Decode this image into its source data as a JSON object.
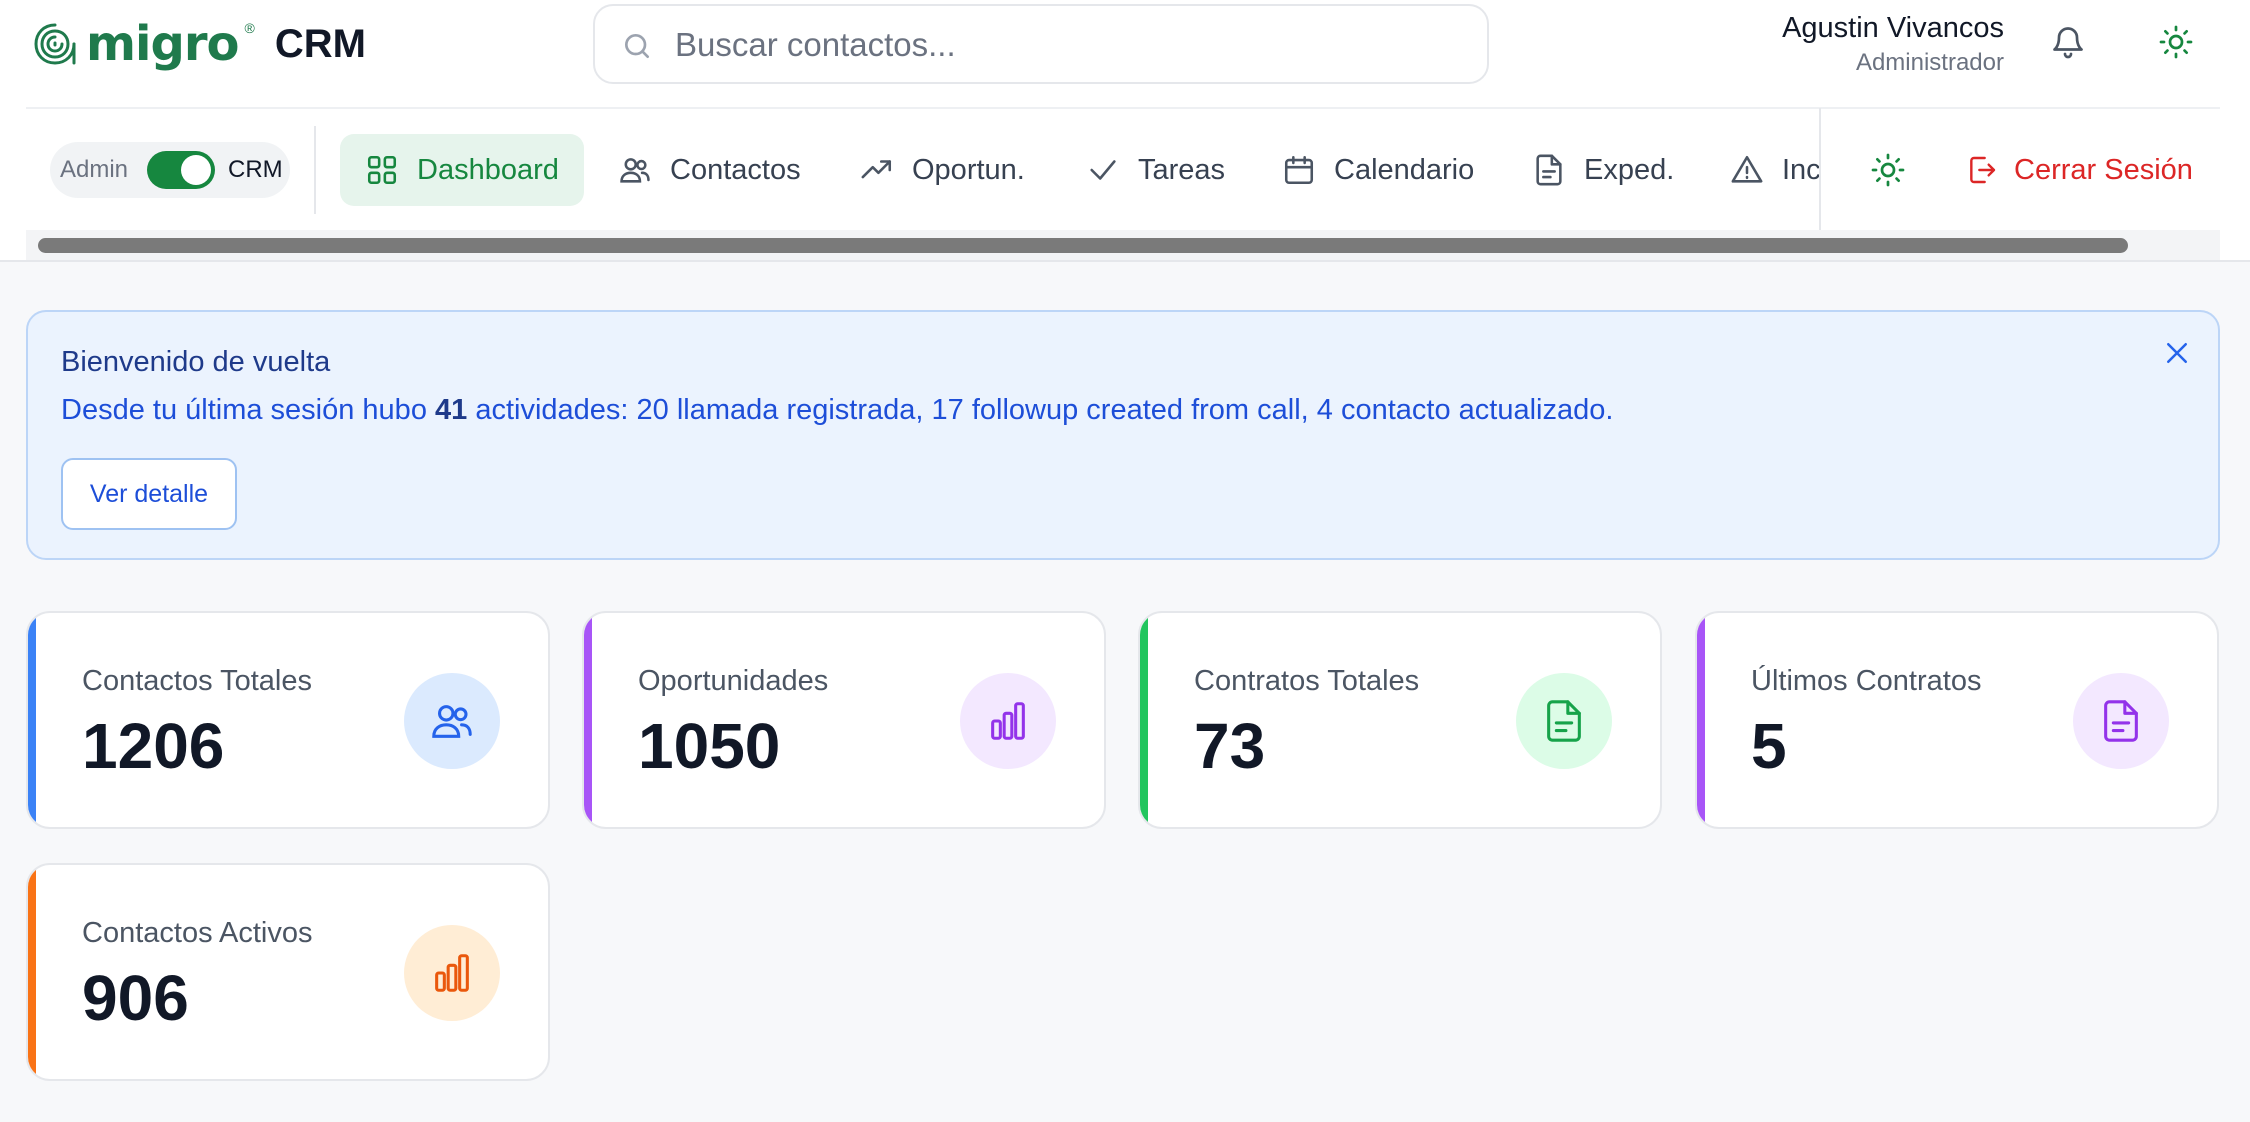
{
  "app": {
    "logo_text": "migro",
    "logo_reg": "®",
    "product": "CRM"
  },
  "search": {
    "placeholder": "Buscar contactos...",
    "value": ""
  },
  "user": {
    "name": "Agustin Vivancos",
    "role": "Administrador"
  },
  "mode_toggle": {
    "left_label": "Admin",
    "right_label": "CRM",
    "state": "CRM"
  },
  "nav": {
    "items": [
      {
        "label": "Dashboard",
        "icon": "grid-icon",
        "active": true
      },
      {
        "label": "Contactos",
        "icon": "users-icon",
        "active": false
      },
      {
        "label": "Oportun.",
        "icon": "trending-up-icon",
        "active": false
      },
      {
        "label": "Tareas",
        "icon": "check-icon",
        "active": false
      },
      {
        "label": "Calendario",
        "icon": "calendar-icon",
        "active": false
      },
      {
        "label": "Exped.",
        "icon": "file-icon",
        "active": false
      },
      {
        "label": "Inc",
        "icon": "alert-triangle-icon",
        "active": false
      }
    ],
    "logout_label": "Cerrar Sesión"
  },
  "banner": {
    "title": "Bienvenido de vuelta",
    "text_prefix": "Desde tu última sesión hubo ",
    "count": "41",
    "text_suffix": " actividades: 20 llamada registrada, 17 followup created from call, 4 contacto actualizado.",
    "button_label": "Ver detalle"
  },
  "stats": [
    {
      "label": "Contactos Totales",
      "value": "1206",
      "icon": "users-icon",
      "accent": "#3b82f6",
      "icon_bg": "#dbeafe",
      "icon_color": "#2563eb"
    },
    {
      "label": "Oportunidades",
      "value": "1050",
      "icon": "bar-chart-icon",
      "accent": "#a855f7",
      "icon_bg": "#f3e8ff",
      "icon_color": "#9333ea"
    },
    {
      "label": "Contratos Totales",
      "value": "73",
      "icon": "file-text-icon",
      "accent": "#22c55e",
      "icon_bg": "#dcfce7",
      "icon_color": "#16a34a"
    },
    {
      "label": "Últimos Contratos",
      "value": "5",
      "icon": "file-text-icon",
      "accent": "#a855f7",
      "icon_bg": "#f3e8ff",
      "icon_color": "#9333ea"
    },
    {
      "label": "Contactos Activos",
      "value": "906",
      "icon": "bar-chart-icon",
      "accent": "#f97316",
      "icon_bg": "#ffedd5",
      "icon_color": "#ea580c"
    }
  ],
  "colors": {
    "brand_green": "#16873f",
    "danger": "#dc2626",
    "banner_blue": "#1d4ed8"
  }
}
